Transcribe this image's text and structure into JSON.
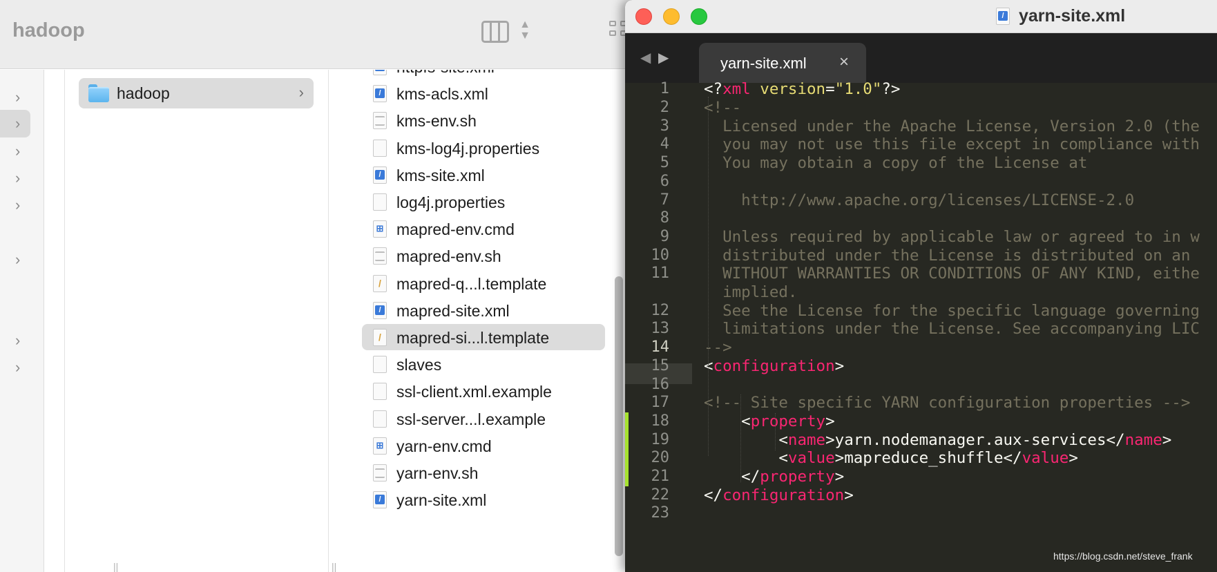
{
  "finder": {
    "title": "hadoop",
    "selected_folder": "hadoop",
    "files": [
      {
        "name": "httpfs-site.xml",
        "type": "xml"
      },
      {
        "name": "kms-acls.xml",
        "type": "xml"
      },
      {
        "name": "kms-env.sh",
        "type": "script"
      },
      {
        "name": "kms-log4j.properties",
        "type": "plain"
      },
      {
        "name": "kms-site.xml",
        "type": "xml"
      },
      {
        "name": "log4j.properties",
        "type": "plain"
      },
      {
        "name": "mapred-env.cmd",
        "type": "win"
      },
      {
        "name": "mapred-env.sh",
        "type": "script"
      },
      {
        "name": "mapred-q...l.template",
        "type": "tpl"
      },
      {
        "name": "mapred-site.xml",
        "type": "xml"
      },
      {
        "name": "mapred-si...l.template",
        "type": "tpl",
        "selected": true
      },
      {
        "name": "slaves",
        "type": "plain"
      },
      {
        "name": "ssl-client.xml.example",
        "type": "plain"
      },
      {
        "name": "ssl-server...l.example",
        "type": "plain"
      },
      {
        "name": "yarn-env.cmd",
        "type": "win"
      },
      {
        "name": "yarn-env.sh",
        "type": "script"
      },
      {
        "name": "yarn-site.xml",
        "type": "xml"
      }
    ]
  },
  "editor": {
    "window_title": "yarn-site.xml",
    "tab_label": "yarn-site.xml",
    "tab_close": "×",
    "line_numbers": [
      "1",
      "2",
      "3",
      "4",
      "5",
      "6",
      "7",
      "8",
      "9",
      "10",
      "11",
      "",
      "12",
      "13",
      "14",
      "15",
      "16",
      "17",
      "18",
      "19",
      "20",
      "21",
      "22",
      "23"
    ],
    "current_line": "14",
    "code_lines": [
      [
        {
          "t": "<?",
          "c": "pun"
        },
        {
          "t": "xml ",
          "c": "tag"
        },
        {
          "t": "version",
          "c": "str"
        },
        {
          "t": "=",
          "c": "pun"
        },
        {
          "t": "\"1.0\"",
          "c": "str"
        },
        {
          "t": "?>",
          "c": "pun"
        }
      ],
      [
        {
          "t": "<!--",
          "c": "cmt"
        }
      ],
      [
        {
          "t": "  Licensed under the Apache License, Version 2.0 (the",
          "c": "cmt"
        }
      ],
      [
        {
          "t": "  you may not use this file except in compliance with",
          "c": "cmt"
        }
      ],
      [
        {
          "t": "  You may obtain a copy of the License at",
          "c": "cmt"
        }
      ],
      [
        {
          "t": "",
          "c": "cmt"
        }
      ],
      [
        {
          "t": "    http://www.apache.org/licenses/LICENSE-2.0",
          "c": "cmt"
        }
      ],
      [
        {
          "t": "",
          "c": "cmt"
        }
      ],
      [
        {
          "t": "  Unless required by applicable law or agreed to in w",
          "c": "cmt"
        }
      ],
      [
        {
          "t": "  distributed under the License is distributed on an",
          "c": "cmt"
        }
      ],
      [
        {
          "t": "  WITHOUT WARRANTIES OR CONDITIONS OF ANY KIND, eithe",
          "c": "cmt"
        }
      ],
      [
        {
          "t": "  implied.",
          "c": "cmt"
        }
      ],
      [
        {
          "t": "  See the License for the specific language governing",
          "c": "cmt"
        }
      ],
      [
        {
          "t": "  limitations under the License. See accompanying LIC",
          "c": "cmt"
        }
      ],
      [
        {
          "t": "-->",
          "c": "cmt"
        }
      ],
      [
        {
          "t": "<",
          "c": "pun"
        },
        {
          "t": "configuration",
          "c": "tag"
        },
        {
          "t": ">",
          "c": "pun"
        }
      ],
      [
        {
          "t": "",
          "c": "pun"
        }
      ],
      [
        {
          "t": "<!-- Site specific YARN configuration properties -->",
          "c": "cmt"
        }
      ],
      [
        {
          "t": "    <",
          "c": "pun"
        },
        {
          "t": "property",
          "c": "tag"
        },
        {
          "t": ">",
          "c": "pun"
        }
      ],
      [
        {
          "t": "        <",
          "c": "pun"
        },
        {
          "t": "name",
          "c": "tag"
        },
        {
          "t": ">yarn.nodemanager.aux-services</",
          "c": "pun"
        },
        {
          "t": "name",
          "c": "tag"
        },
        {
          "t": ">",
          "c": "pun"
        }
      ],
      [
        {
          "t": "        <",
          "c": "pun"
        },
        {
          "t": "value",
          "c": "tag"
        },
        {
          "t": ">mapreduce_shuffle</",
          "c": "pun"
        },
        {
          "t": "value",
          "c": "tag"
        },
        {
          "t": ">",
          "c": "pun"
        }
      ],
      [
        {
          "t": "    </",
          "c": "pun"
        },
        {
          "t": "property",
          "c": "tag"
        },
        {
          "t": ">",
          "c": "pun"
        }
      ],
      [
        {
          "t": "</",
          "c": "pun"
        },
        {
          "t": "configuration",
          "c": "tag"
        },
        {
          "t": ">",
          "c": "pun"
        }
      ],
      [
        {
          "t": "",
          "c": "pun"
        }
      ]
    ],
    "modified_lines": [
      "18",
      "19",
      "20",
      "21"
    ]
  },
  "watermark": "https://blog.csdn.net/steve_frank",
  "colors": {
    "editor_bg": "#272822",
    "comment": "#75715e",
    "tag": "#f92672",
    "string": "#e6db74",
    "text": "#f8f8f2",
    "modified_bar": "#a6e22e",
    "selection": "#dcdcdc"
  },
  "icons": {
    "sidebar_chevron": "chevron-right-icon",
    "folder": "folder-icon",
    "close_tab": "close-icon"
  }
}
